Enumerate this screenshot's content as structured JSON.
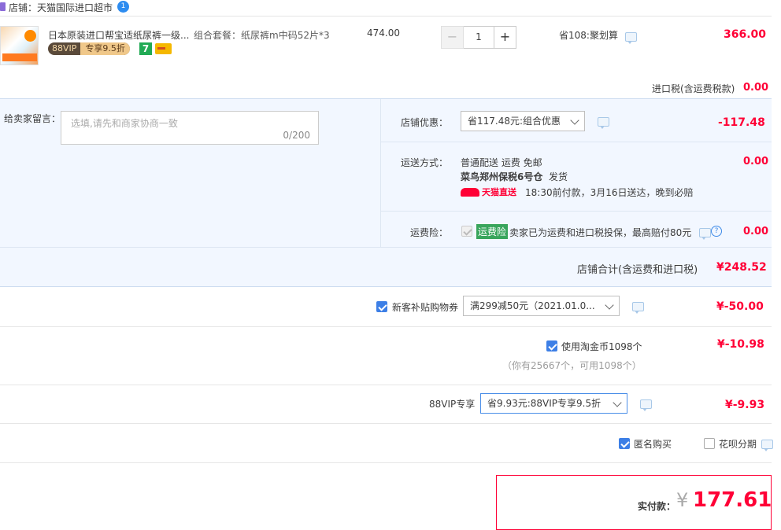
{
  "shop": {
    "label": "店铺：天猫国际进口超市",
    "badge": "1"
  },
  "item": {
    "title": "日本原装进口帮宝适纸尿裤一级...",
    "vip_tag": "88VIP",
    "vip_discount": "专享9.5折",
    "sku": "组合套餐：纸尿裤m中码52片*3",
    "unit_price": "474.00",
    "quantity": "1",
    "minus": "−",
    "plus": "+",
    "promo": "省108:聚划算",
    "subtotal": "366.00"
  },
  "import_tax": {
    "label": "进口税(含运费税款)",
    "value": "0.00"
  },
  "message": {
    "label": "给卖家留言：",
    "placeholder": "选填,请先和商家协商一致",
    "counter": "0/200"
  },
  "shop_discount": {
    "label": "店铺优惠：",
    "selected": "省117.48元:组合优惠",
    "value": "-117.48"
  },
  "shipping": {
    "label": "运送方式：",
    "method": "普通配送 运费 免邮",
    "warehouse": "菜鸟郑州保税6号仓",
    "status": "发货",
    "tmall_tag": "天猫直送",
    "delivery": "18:30前付款，3月16日送达，晚到必赔",
    "value": "0.00"
  },
  "insurance": {
    "label": "运费险：",
    "tag": "运费险",
    "desc": "卖家已为运费和进口税投保，最高赔付80元",
    "value": "0.00"
  },
  "shop_total": {
    "label": "店铺合计(含运费和进口税)",
    "value": "¥248.52"
  },
  "coupon": {
    "label": "新客补贴购物券",
    "selected": "满299减50元（2021.01.0...",
    "value": "¥-50.00"
  },
  "taojinbi": {
    "label": "使用淘金币1098个",
    "note": "（你有25667个，可用1098个）",
    "value": "¥-10.98"
  },
  "vip88": {
    "label": "88VIP专享",
    "selected": "省9.93元:88VIP专享9.5折",
    "value": "¥-9.93"
  },
  "options": {
    "anonymous": "匿名购买",
    "huabei": "花呗分期"
  },
  "pay": {
    "label": "实付款：",
    "currency": "¥",
    "value": "177.61"
  },
  "colors": {
    "accent": "#ff0036",
    "checkbox": "#3d7fe6",
    "panel_bg": "#f2f7ff",
    "vip_bg": "#5a4a3a"
  }
}
